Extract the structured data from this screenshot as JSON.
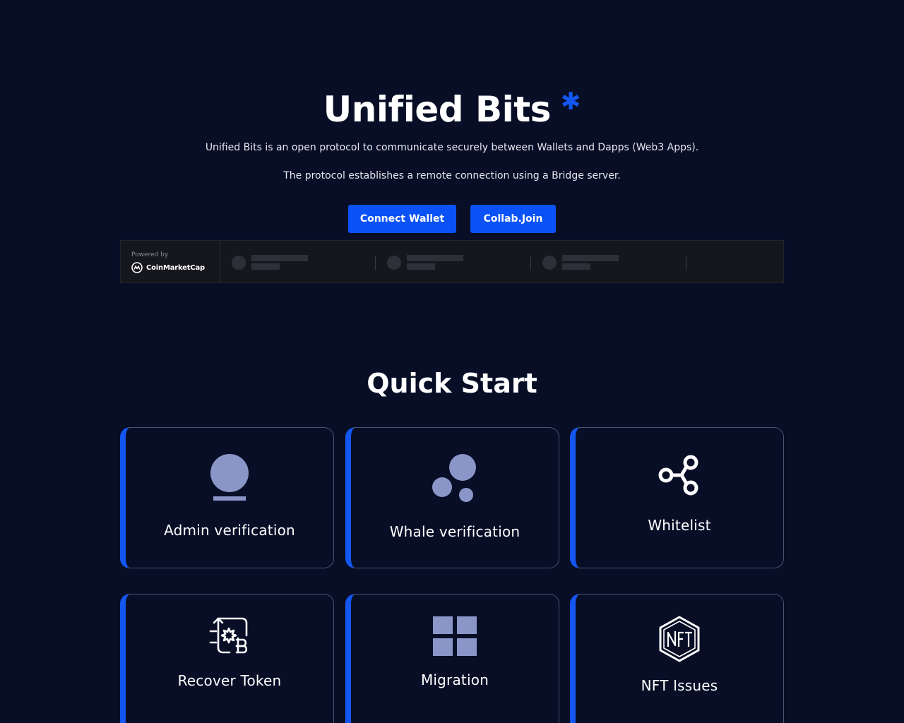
{
  "hero": {
    "title": "Unified Bits",
    "title_mark": "✱",
    "description_1": "Unified Bits is an open protocol to communicate securely between Wallets and Dapps (Web3 Apps).",
    "description_2": "The protocol establishes a remote connection using a Bridge server.",
    "buttons": {
      "connect_wallet": "Connect Wallet",
      "collab_join": "Collab.Join"
    }
  },
  "ticker_widget": {
    "powered_by": "Powered by",
    "brand": "CoinMarketCap"
  },
  "quick_start": {
    "title": "Quick Start",
    "cards": [
      {
        "label": "Admin verification",
        "icon": "user-icon"
      },
      {
        "label": "Whale verification",
        "icon": "bubbles-icon"
      },
      {
        "label": "Whitelist",
        "icon": "share-nodes-icon"
      },
      {
        "label": "Recover Token",
        "icon": "bitcoin-exchange-icon"
      },
      {
        "label": "Migration",
        "icon": "grid-icon"
      },
      {
        "label": "NFT Issues",
        "icon": "nft-hexagon-icon"
      }
    ]
  },
  "colors": {
    "background": "#070e26",
    "accent": "#1456f0",
    "button": "#0a52f5",
    "icon_fill": "#8b96c8",
    "card_border": "#4c5271"
  }
}
